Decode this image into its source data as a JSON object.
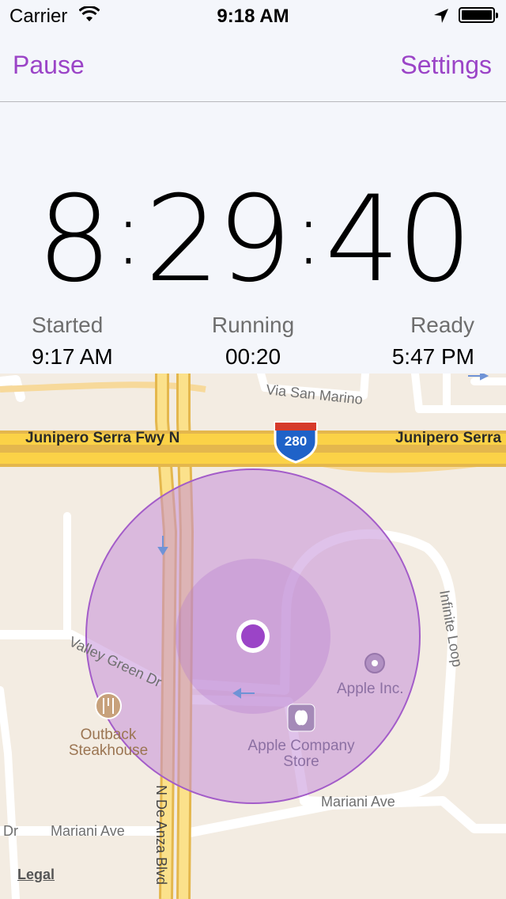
{
  "status_bar": {
    "carrier": "Carrier",
    "time": "9:18 AM",
    "battery_level": 1.0
  },
  "nav": {
    "left_button": "Pause",
    "right_button": "Settings"
  },
  "timer": {
    "hours": "8",
    "minutes": "29",
    "seconds": "40"
  },
  "stats": {
    "started": {
      "label": "Started",
      "value": "9:17 AM"
    },
    "running": {
      "label": "Running",
      "value": "00:20"
    },
    "ready": {
      "label": "Ready",
      "value": "5:47 PM"
    }
  },
  "map": {
    "labels": {
      "street_san_marino": "Via San Marino",
      "freeway_left": "Junipero Serra Fwy N",
      "freeway_right": "Junipero Serra",
      "shield": "280",
      "valley_green": "Valley Green Dr",
      "infinite_loop": "Infinite Loop",
      "apple_inc": "Apple Inc.",
      "outback_line1": "Outback",
      "outback_line2": "Steakhouse",
      "apple_store_line1": "Apple Company",
      "apple_store_line2": "Store",
      "mariani_right": "Mariani Ave",
      "mariani_left": "Mariani Ave",
      "dr_left": "Dr",
      "de_anza": "N De Anza Blvd"
    },
    "legal": "Legal",
    "accent_color": "#9b44c7",
    "accuracy_fill": "#c48fd9"
  }
}
